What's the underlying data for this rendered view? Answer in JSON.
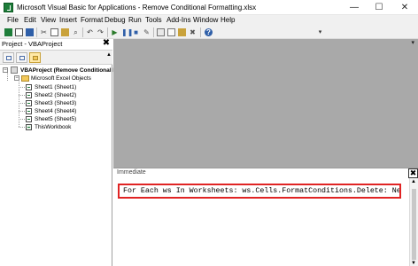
{
  "window": {
    "title": "Microsoft Visual Basic for Applications - Remove Conditional Formatting.xlsx",
    "minimize_glyph": "—",
    "maximize_glyph": "☐",
    "close_glyph": "✕"
  },
  "menu": [
    "File",
    "Edit",
    "View",
    "Insert",
    "Format",
    "Debug",
    "Run",
    "Tools",
    "Add-Ins",
    "Window",
    "Help"
  ],
  "toolbar": {
    "icons": [
      "excel-icon",
      "insert-module-icon",
      "save-icon",
      "cut-icon",
      "copy-icon",
      "paste-icon",
      "find-icon",
      "undo-icon",
      "redo-icon",
      "run-icon",
      "break-icon",
      "reset-icon",
      "design-mode-icon",
      "project-explorer-icon",
      "properties-icon",
      "object-browser-icon",
      "toolbox-icon",
      "help-icon"
    ]
  },
  "project_pane": {
    "title": "Project - VBAProject",
    "close_glyph": "✖",
    "tree": {
      "root": "VBAProject (Remove Conditional Fo",
      "folder": "Microsoft Excel Objects",
      "items": [
        "Sheet1 (Sheet1)",
        "Sheet2 (Sheet2)",
        "Sheet3 (Sheet3)",
        "Sheet4 (Sheet4)",
        "Sheet5 (Sheet5)",
        "ThisWorkbook"
      ]
    }
  },
  "immediate": {
    "title": "Immediate",
    "close_glyph": "✖",
    "code": "For Each ws In Worksheets: ws.Cells.FormatConditions.Delete: Next ws"
  },
  "colors": {
    "mdi_background": "#a9a9a9",
    "highlight_border": "#e02424"
  }
}
